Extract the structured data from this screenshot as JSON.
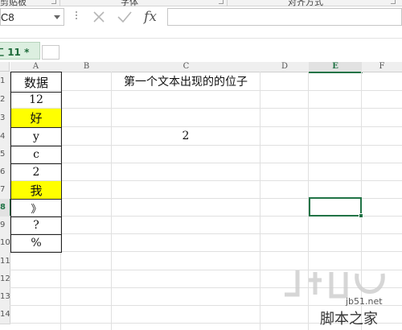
{
  "ribbon": {
    "groups": [
      "剪贴板",
      "字体",
      "对齐方式"
    ],
    "accent": "#217346"
  },
  "formula_bar": {
    "name_box": "C8",
    "cancel_icon": "close-icon",
    "enter_icon": "check-icon",
    "fx_label": "fx",
    "formula": ""
  },
  "sheet": {
    "tab_label": "11 *",
    "tab_prefix": "工"
  },
  "columns": [
    "A",
    "B",
    "C",
    "D",
    "E",
    "F"
  ],
  "active_column": "E",
  "rows": [
    "1",
    "2",
    "3",
    "4",
    "5",
    "6",
    "7",
    "8",
    "9",
    "10",
    "11",
    "12",
    "13",
    "14"
  ],
  "active_row": "8",
  "cells": {
    "A1": "数据",
    "A2": "12",
    "A3": "好",
    "A4": "y",
    "A5": "c",
    "A6": "2",
    "A7": "我",
    "A8": "》",
    "A9": "?",
    "A10": "%",
    "C1": "第一个文本出现的的位子",
    "C4": "2"
  },
  "highlight_color": "#ffff00",
  "watermark": {
    "text": "jb51.net",
    "sub": "脚本之家"
  }
}
